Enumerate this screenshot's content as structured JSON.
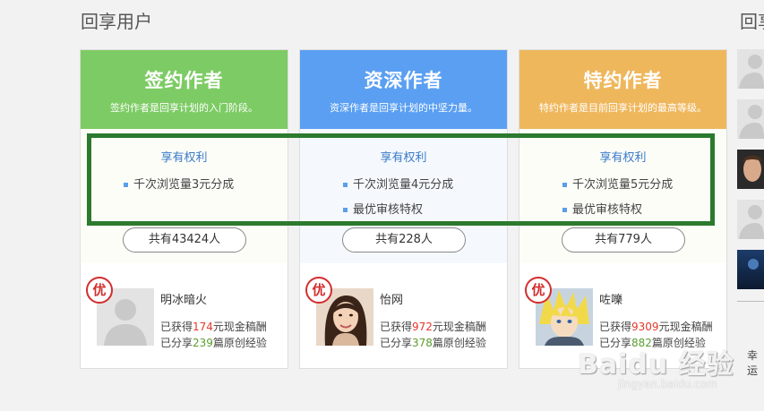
{
  "section": {
    "title": "回享用户",
    "title_right": "回享"
  },
  "cards": [
    {
      "name": "签约作者",
      "desc": "签约作者是回享计划的入门阶段。",
      "color": "#7dcb64",
      "body_bg": "#fdfdf8",
      "benefit_title": "享有权利",
      "benefits": [
        "千次浏览量3元分成"
      ],
      "count": "共有43424人",
      "badge": "优",
      "user": {
        "name": "明冰暗火",
        "stat1_pre": "已获得",
        "stat1_num": "174",
        "stat1_post": "元现金稿酬",
        "stat2_pre": "已分享",
        "stat2_num": "239",
        "stat2_post": "篇原创经验",
        "avatar": "default-avatar"
      }
    },
    {
      "name": "资深作者",
      "desc": "资深作者是回享计划的中坚力量。",
      "color": "#5a9ff2",
      "body_bg": "#f5f9fe",
      "benefit_title": "享有权利",
      "benefits": [
        "千次浏览量4元分成",
        "最优审核特权"
      ],
      "count": "共有228人",
      "badge": "优",
      "user": {
        "name": "怡网",
        "stat1_pre": "已获得",
        "stat1_num": "972",
        "stat1_post": "元现金稿酬",
        "stat2_pre": "已分享",
        "stat2_num": "378",
        "stat2_post": "篇原创经验",
        "avatar": "woman-photo"
      }
    },
    {
      "name": "特约作者",
      "desc": "特约作者是目前回享计划的最高等级。",
      "color": "#efb75c",
      "body_bg": "#fdfdf8",
      "benefit_title": "享有权利",
      "benefits": [
        "千次浏览量5元分成",
        "最优审核特权"
      ],
      "count": "共有779人",
      "badge": "优",
      "user": {
        "name": "咗嚛",
        "stat1_pre": "已获得",
        "stat1_num": "9309",
        "stat1_post": "元现金稿酬",
        "stat2_pre": "已分享",
        "stat2_num": "882",
        "stat2_post": "篇原创经验",
        "avatar": "anime-avatar"
      }
    }
  ],
  "side": {
    "text": "幸运"
  },
  "watermark": {
    "main": "Baidu 经验",
    "sub": "jingyan.baidu.com"
  }
}
